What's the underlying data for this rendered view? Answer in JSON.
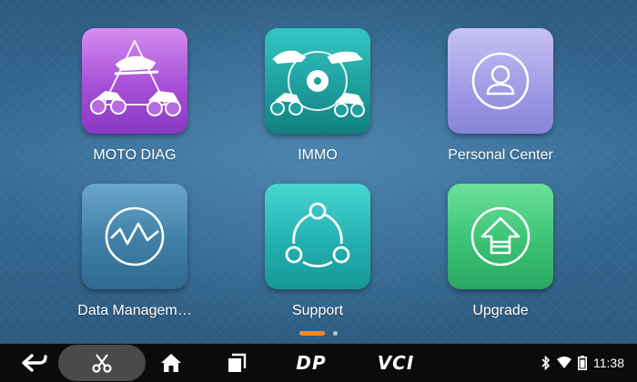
{
  "apps": [
    {
      "label": "MOTO DIAG",
      "icon": "motorcycle-diag-icon"
    },
    {
      "label": "IMMO",
      "icon": "immobilizer-key-icon"
    },
    {
      "label": "Personal Center",
      "icon": "person-icon"
    },
    {
      "label": "Data Managem…",
      "icon": "chart-line-icon"
    },
    {
      "label": "Support",
      "icon": "share-nodes-icon"
    },
    {
      "label": "Upgrade",
      "icon": "upgrade-arrow-icon"
    }
  ],
  "pager": {
    "pages": 2,
    "current": 1
  },
  "navbar": {
    "back_icon": "back-arrow-icon",
    "screenshot_icon": "scissors-icon",
    "home_icon": "home-icon",
    "recents_icon": "recent-apps-icon",
    "brand_dp": "DP",
    "brand_vci": "VCI"
  },
  "status": {
    "bluetooth_icon": "bluetooth-icon",
    "wifi_icon": "wifi-icon",
    "battery_icon": "battery-icon",
    "time": "11:38"
  },
  "colors": {
    "pager_active": "#f08a2a",
    "moto": "#a54fd6",
    "immo": "#1f9f9f",
    "person": "#a19ce6",
    "data": "#3f7fa6",
    "support": "#24b0b0",
    "upgrade": "#3cc275"
  }
}
